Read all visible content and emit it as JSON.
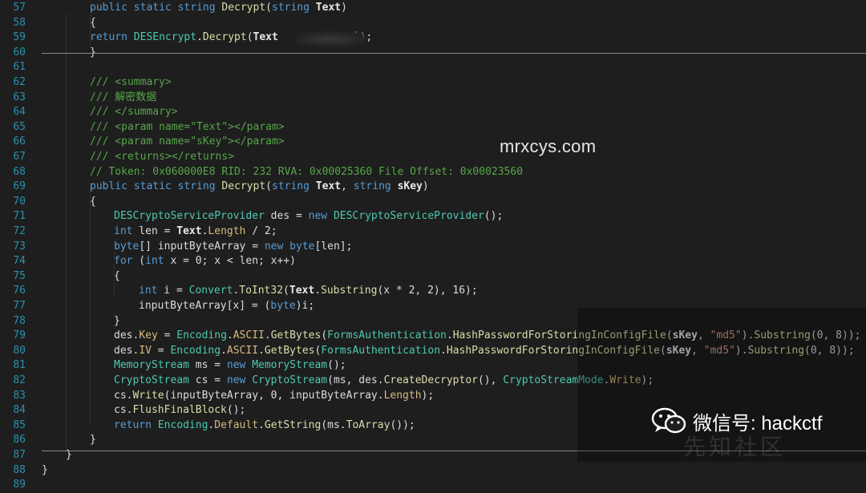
{
  "watermark_top": "mrxcys.com",
  "watermark_bottom": {
    "icon": "wechat-icon",
    "label": "微信号: hackctf"
  },
  "faint_logo": "先知社区",
  "lines": [
    {
      "n": "57",
      "tokens": [
        [
          "kw",
          "public static string "
        ],
        [
          "mt",
          "Decrypt"
        ],
        [
          "txt",
          "("
        ],
        [
          "kw",
          "string "
        ],
        [
          "pm",
          "Text"
        ],
        [
          "txt",
          ")"
        ]
      ]
    },
    {
      "n": "58",
      "tokens": [
        [
          "txt",
          "{"
        ]
      ]
    },
    {
      "n": "59",
      "tokens": [
        [
          "kw",
          "return "
        ],
        [
          "ty",
          "DESEncrypt"
        ],
        [
          "txt",
          "."
        ],
        [
          "mt",
          "Decrypt"
        ],
        [
          "txt",
          "("
        ],
        [
          "pm",
          "Text"
        ],
        [
          "txt",
          "            `);"
        ]
      ]
    },
    {
      "n": "60",
      "tokens": [
        [
          "txt",
          "}"
        ]
      ]
    },
    {
      "n": "61",
      "tokens": []
    },
    {
      "n": "62",
      "tokens": [
        [
          "cm",
          "/// <summary>"
        ]
      ]
    },
    {
      "n": "63",
      "tokens": [
        [
          "cm",
          "/// 解密数据"
        ]
      ]
    },
    {
      "n": "64",
      "tokens": [
        [
          "cm",
          "/// </summary>"
        ]
      ]
    },
    {
      "n": "65",
      "tokens": [
        [
          "cm",
          "/// <param name=\"Text\"></param>"
        ]
      ]
    },
    {
      "n": "66",
      "tokens": [
        [
          "cm",
          "/// <param name=\"sKey\"></param>"
        ]
      ]
    },
    {
      "n": "67",
      "tokens": [
        [
          "cm",
          "/// <returns></returns>"
        ]
      ]
    },
    {
      "n": "68",
      "tokens": [
        [
          "cm",
          "// Token: 0x060000E8 RID: 232 RVA: 0x00025360 File Offset: 0x00023560"
        ]
      ]
    },
    {
      "n": "69",
      "tokens": [
        [
          "kw",
          "public static string "
        ],
        [
          "mt",
          "Decrypt"
        ],
        [
          "txt",
          "("
        ],
        [
          "kw",
          "string "
        ],
        [
          "pm",
          "Text"
        ],
        [
          "txt",
          ", "
        ],
        [
          "kw",
          "string "
        ],
        [
          "pm",
          "sKey"
        ],
        [
          "txt",
          ")"
        ]
      ]
    },
    {
      "n": "70",
      "tokens": [
        [
          "txt",
          "{"
        ]
      ]
    },
    {
      "n": "71",
      "tokens": [
        [
          "ty",
          "DESCryptoServiceProvider"
        ],
        [
          "txt",
          " des = "
        ],
        [
          "kw",
          "new "
        ],
        [
          "ty",
          "DESCryptoServiceProvider"
        ],
        [
          "txt",
          "();"
        ]
      ]
    },
    {
      "n": "72",
      "tokens": [
        [
          "kw",
          "int"
        ],
        [
          "txt",
          " len = "
        ],
        [
          "pm",
          "Text"
        ],
        [
          "txt",
          "."
        ],
        [
          "pr",
          "Length"
        ],
        [
          "txt",
          " / 2;"
        ]
      ]
    },
    {
      "n": "73",
      "tokens": [
        [
          "kw",
          "byte"
        ],
        [
          "txt",
          "[] inputByteArray = "
        ],
        [
          "kw",
          "new byte"
        ],
        [
          "txt",
          "[len];"
        ]
      ]
    },
    {
      "n": "74",
      "tokens": [
        [
          "kw",
          "for"
        ],
        [
          "txt",
          " ("
        ],
        [
          "kw",
          "int"
        ],
        [
          "txt",
          " x = 0; x < len; x++)"
        ]
      ]
    },
    {
      "n": "75",
      "tokens": [
        [
          "txt",
          "{"
        ]
      ]
    },
    {
      "n": "76",
      "tokens": [
        [
          "kw",
          "int"
        ],
        [
          "txt",
          " i = "
        ],
        [
          "ty",
          "Convert"
        ],
        [
          "txt",
          "."
        ],
        [
          "mt",
          "ToInt32"
        ],
        [
          "txt",
          "("
        ],
        [
          "pm",
          "Text"
        ],
        [
          "txt",
          "."
        ],
        [
          "mt",
          "Substring"
        ],
        [
          "txt",
          "(x * 2, 2), 16);"
        ]
      ]
    },
    {
      "n": "77",
      "tokens": [
        [
          "txt",
          "inputByteArray[x] = ("
        ],
        [
          "kw",
          "byte"
        ],
        [
          "txt",
          ")i;"
        ]
      ]
    },
    {
      "n": "78",
      "tokens": [
        [
          "txt",
          "}"
        ]
      ]
    },
    {
      "n": "79",
      "tokens": [
        [
          "txt",
          "des."
        ],
        [
          "pr",
          "Key"
        ],
        [
          "txt",
          " = "
        ],
        [
          "ty",
          "Encoding"
        ],
        [
          "txt",
          "."
        ],
        [
          "pr",
          "ASCII"
        ],
        [
          "txt",
          "."
        ],
        [
          "mt",
          "GetBytes"
        ],
        [
          "txt",
          "("
        ],
        [
          "ty",
          "FormsAuthentication"
        ],
        [
          "txt",
          "."
        ],
        [
          "mt",
          "HashPasswordForStoringInConfigFile"
        ],
        [
          "txt",
          "("
        ],
        [
          "pm",
          "sKey"
        ],
        [
          "txt",
          ", "
        ],
        [
          "st",
          "\"md5\""
        ],
        [
          "txt",
          ")."
        ],
        [
          "mt",
          "Substring"
        ],
        [
          "txt",
          "(0, 8));"
        ]
      ]
    },
    {
      "n": "80",
      "tokens": [
        [
          "txt",
          "des."
        ],
        [
          "pr",
          "IV"
        ],
        [
          "txt",
          " = "
        ],
        [
          "ty",
          "Encoding"
        ],
        [
          "txt",
          "."
        ],
        [
          "pr",
          "ASCII"
        ],
        [
          "txt",
          "."
        ],
        [
          "mt",
          "GetBytes"
        ],
        [
          "txt",
          "("
        ],
        [
          "ty",
          "FormsAuthentication"
        ],
        [
          "txt",
          "."
        ],
        [
          "mt",
          "HashPasswordForStoringInConfigFile"
        ],
        [
          "txt",
          "("
        ],
        [
          "pm",
          "sKey"
        ],
        [
          "txt",
          ", "
        ],
        [
          "st",
          "\"md5\""
        ],
        [
          "txt",
          ")."
        ],
        [
          "mt",
          "Substring"
        ],
        [
          "txt",
          "(0, 8));"
        ]
      ]
    },
    {
      "n": "81",
      "tokens": [
        [
          "ty",
          "MemoryStream"
        ],
        [
          "txt",
          " ms = "
        ],
        [
          "kw",
          "new "
        ],
        [
          "ty",
          "MemoryStream"
        ],
        [
          "txt",
          "();"
        ]
      ]
    },
    {
      "n": "82",
      "tokens": [
        [
          "ty",
          "CryptoStream"
        ],
        [
          "txt",
          " cs = "
        ],
        [
          "kw",
          "new "
        ],
        [
          "ty",
          "CryptoStream"
        ],
        [
          "txt",
          "(ms, des."
        ],
        [
          "mt",
          "CreateDecryptor"
        ],
        [
          "txt",
          "(), "
        ],
        [
          "ty",
          "CryptoStreamMode"
        ],
        [
          "txt",
          "."
        ],
        [
          "pr",
          "Write"
        ],
        [
          "txt",
          ");"
        ]
      ]
    },
    {
      "n": "83",
      "tokens": [
        [
          "txt",
          "cs."
        ],
        [
          "mt",
          "Write"
        ],
        [
          "txt",
          "(inputByteArray, 0, inputByteArray."
        ],
        [
          "pr",
          "Length"
        ],
        [
          "txt",
          ");"
        ]
      ]
    },
    {
      "n": "84",
      "tokens": [
        [
          "txt",
          "cs."
        ],
        [
          "mt",
          "FlushFinalBlock"
        ],
        [
          "txt",
          "();"
        ]
      ]
    },
    {
      "n": "85",
      "tokens": [
        [
          "kw",
          "return "
        ],
        [
          "ty",
          "Encoding"
        ],
        [
          "txt",
          "."
        ],
        [
          "pr",
          "Default"
        ],
        [
          "txt",
          "."
        ],
        [
          "mt",
          "GetString"
        ],
        [
          "txt",
          "(ms."
        ],
        [
          "mt",
          "ToArray"
        ],
        [
          "txt",
          "());"
        ]
      ]
    },
    {
      "n": "86",
      "tokens": [
        [
          "txt",
          "}"
        ]
      ]
    },
    {
      "n": "87",
      "tokens": [
        [
          "txt",
          "}"
        ]
      ]
    },
    {
      "n": "88",
      "tokens": [
        [
          "txt",
          "}"
        ]
      ]
    },
    {
      "n": "89",
      "tokens": []
    }
  ]
}
